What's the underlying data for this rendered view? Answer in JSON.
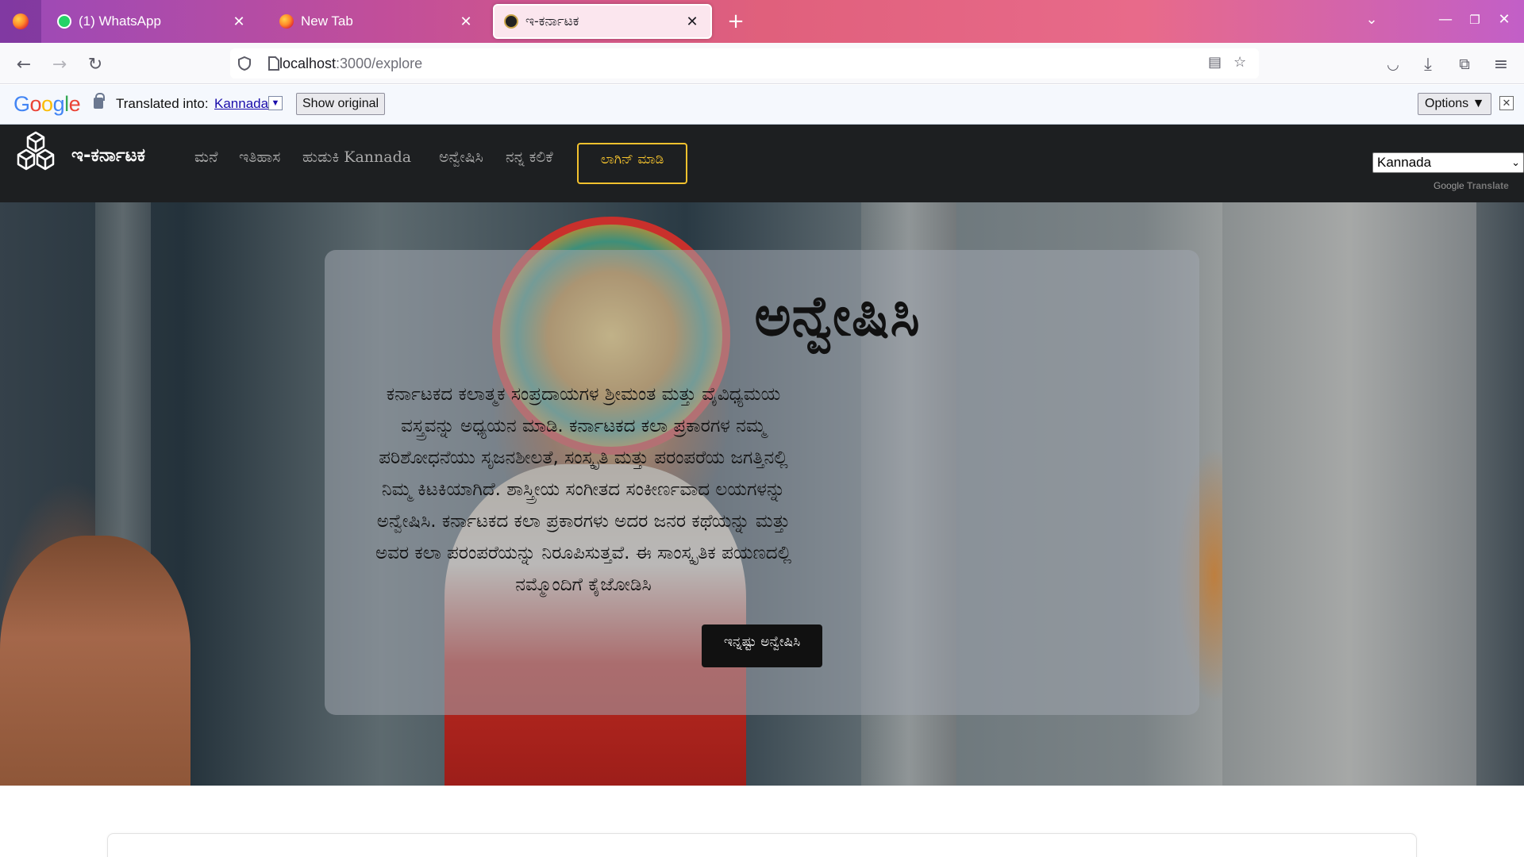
{
  "browser": {
    "tabs": [
      {
        "title": "(1) WhatsApp",
        "favicon": "whatsapp-icon"
      },
      {
        "title": "New Tab",
        "favicon": "firefox-icon"
      },
      {
        "title": "ಇ-ಕರ್ನಾಟಕ",
        "favicon": "site-icon",
        "active": true
      }
    ],
    "url_host": "localhost",
    "url_path": ":3000/explore"
  },
  "translate_bar": {
    "label": "Translated into:",
    "language": "Kannada",
    "show_original": "Show original",
    "options": "Options ▼"
  },
  "site": {
    "brand": "ಇ-ಕರ್ನಾಟಕ",
    "nav": [
      "ಮನೆ",
      "ಇತಿಹಾಸ",
      "ಹುಡುಕಿ Kannada",
      "ಅನ್ವೇಷಿಸಿ",
      "ನನ್ನ ಕಲಿಕೆ"
    ],
    "login": "ಲಾಗಿನ್ ಮಾಡಿ",
    "language_select": "Kannada",
    "powered_google": "Google",
    "powered_translate": "Translate"
  },
  "hero": {
    "title": "ಅನ್ವೇಷಿಸಿ",
    "text": "ಕರ್ನಾಟಕದ ಕಲಾತ್ಮಕ ಸಂಪ್ರದಾಯಗಳ ಶ್ರೀಮಂತ ಮತ್ತು ವೈವಿಧ್ಯಮಯ ವಸ್ತ್ರವನ್ನು ಅಧ್ಯಯನ ಮಾಡಿ. ಕರ್ನಾಟಕದ ಕಲಾ ಪ್ರಕಾರಗಳ ನಮ್ಮ ಪರಿಶೋಧನೆಯು ಸೃಜನಶೀಲತೆ, ಸಂಸ್ಕೃತಿ ಮತ್ತು ಪರಂಪರೆಯ ಜಗತ್ತಿನಲ್ಲಿ ನಿಮ್ಮ ಕಿಟಕಿಯಾಗಿದೆ. ಶಾಸ್ತ್ರೀಯ ಸಂಗೀತದ ಸಂಕೀರ್ಣವಾದ ಲಯಗಳನ್ನು ಅನ್ವೇಷಿಸಿ. ಕರ್ನಾಟಕದ ಕಲಾ ಪ್ರಕಾರಗಳು ಅದರ ಜನರ ಕಥೆಯನ್ನು ಮತ್ತು ಅವರ ಕಲಾ ಪರಂಪರೆಯನ್ನು ನಿರೂಪಿಸುತ್ತವೆ. ಈ ಸಾಂಸ್ಕೃತಿಕ ಪಯಣದಲ್ಲಿ ನಮ್ಮೊಂದಿಗೆ ಕೈಜೋಡಿಸಿ",
    "button": "ಇನ್ನಷ್ಟು ಅನ್ವೇಷಿಸಿ"
  },
  "colors": {
    "header_bg": "#1d1f21",
    "accent": "#f2c12e"
  }
}
